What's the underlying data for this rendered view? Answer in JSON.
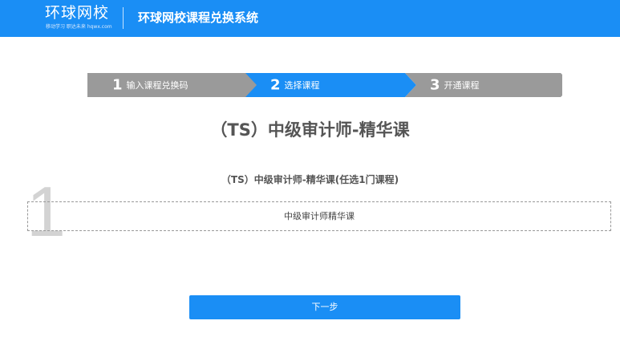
{
  "header": {
    "logo_main": "环球网校",
    "logo_sub": "移动学习  职达未来  hqwx.com",
    "title": "环球网校课程兑换系统"
  },
  "steps": [
    {
      "number": "1",
      "label": "输入课程兑换码",
      "active": false
    },
    {
      "number": "2",
      "label": "选择课程",
      "active": true
    },
    {
      "number": "3",
      "label": "开通课程",
      "active": false
    }
  ],
  "colors": {
    "brand": "#1a8ef5",
    "step_inactive": "#9a9a9a",
    "step_active": "#1a8ef5"
  },
  "course": {
    "title": "（TS）中级审计师-精华课"
  },
  "group": {
    "index": "1",
    "heading": "（TS）中级审计师-精华课(任选1门课程)",
    "options": [
      {
        "label": "中级审计师精华课"
      }
    ]
  },
  "actions": {
    "next_label": "下一步"
  }
}
